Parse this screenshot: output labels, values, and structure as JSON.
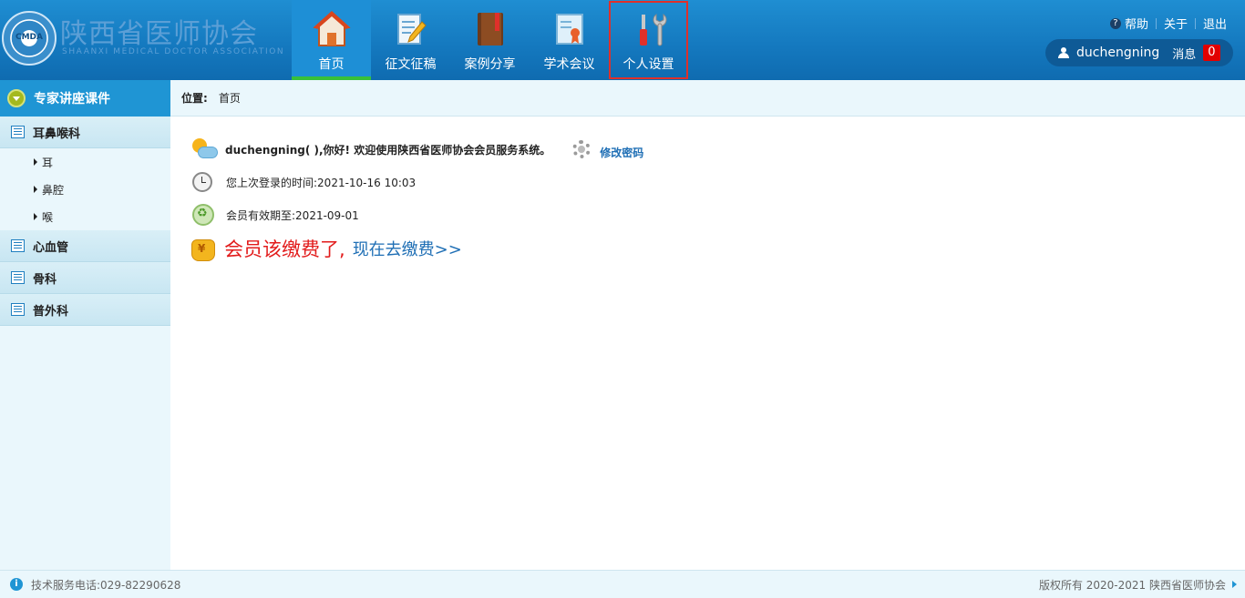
{
  "header": {
    "org_name_cn": "陕西省医师协会",
    "org_name_en": "SHAANXI MEDICAL DOCTOR ASSOCIATION",
    "logo_text": "CMDA",
    "nav": [
      {
        "label": "首页",
        "icon": "home-icon"
      },
      {
        "label": "征文征稿",
        "icon": "write-icon"
      },
      {
        "label": "案例分享",
        "icon": "book-icon"
      },
      {
        "label": "学术会议",
        "icon": "certificate-icon"
      },
      {
        "label": "个人设置",
        "icon": "tools-icon"
      }
    ],
    "links": {
      "help": "帮助",
      "about": "关于",
      "logout": "退出"
    },
    "user": {
      "name": "duchengning",
      "msg_label": "消息",
      "msg_count": "0"
    }
  },
  "sidebar": {
    "title": "专家讲座课件",
    "categories": [
      {
        "label": "耳鼻喉科",
        "subs": [
          "耳",
          "鼻腔",
          "喉"
        ]
      },
      {
        "label": "心血管"
      },
      {
        "label": "骨科"
      },
      {
        "label": "普外科"
      }
    ]
  },
  "breadcrumb": {
    "label": "位置:",
    "current": "首页"
  },
  "main": {
    "greeting": "duchengning( ),你好! 欢迎使用陕西省医师协会会员服务系统。",
    "change_password": "修改密码",
    "last_login": "您上次登录的时间:2021-10-16 10:03",
    "valid_until": "会员有效期至:2021-09-01",
    "pay_warning": "会员该缴费了,",
    "pay_link": "现在去缴费>>"
  },
  "footer": {
    "phone": "技术服务电话:029-82290628",
    "copyright": "版权所有 2020-2021 陕西省医师协会"
  },
  "colors": {
    "header": "#1478be",
    "active_nav": "#1e8fd6",
    "active_underline": "#38c03b",
    "highlight_box": "#e0302a",
    "warning": "#e21b1b",
    "link": "#1f6fb5"
  }
}
